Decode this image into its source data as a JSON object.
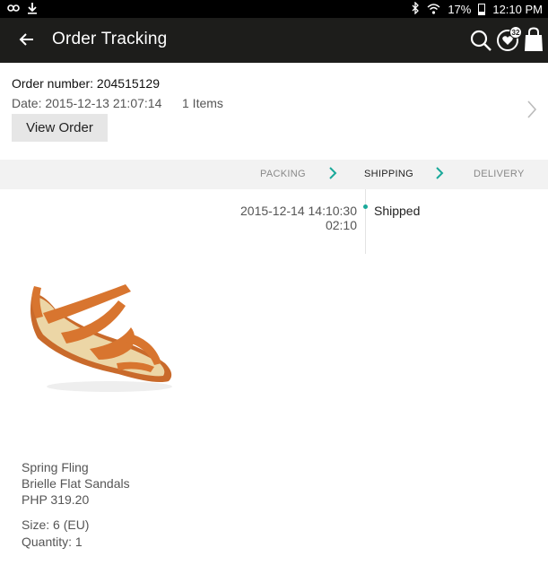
{
  "status_bar": {
    "battery": "17%",
    "time": "12:10 PM",
    "icons": [
      "link-icon",
      "download-icon",
      "bluetooth-icon",
      "wifi-icon",
      "battery-icon"
    ]
  },
  "app_bar": {
    "title": "Order Tracking",
    "wishlist_count": "32",
    "icons": [
      "back-arrow-icon",
      "search-icon",
      "heart-icon",
      "shopping-bag-icon"
    ]
  },
  "order": {
    "number_text": "Order number: 204515129",
    "date_text": "Date: 2015-12-13 21:07:14",
    "items_text": "1 Items",
    "view_order_label": "View Order"
  },
  "steps": [
    {
      "label": "PACKING",
      "active": false
    },
    {
      "label": "SHIPPING",
      "active": true
    },
    {
      "label": "DELIVERY",
      "active": false
    }
  ],
  "timeline": [
    {
      "date": "2015-12-14 14:10:30",
      "time": "02:10",
      "status": "Shipped"
    }
  ],
  "product": {
    "brand": "Spring Fling",
    "name": "Brielle Flat Sandals",
    "price": "PHP 319.20",
    "size_text": "Size: 6 (EU)",
    "quantity_text": "Quantity: 1"
  },
  "colors": {
    "app_bar": "#1d1d1b",
    "accent": "#1aa99a",
    "step_bar": "#f2f2f2",
    "button": "#e6e6e6"
  }
}
